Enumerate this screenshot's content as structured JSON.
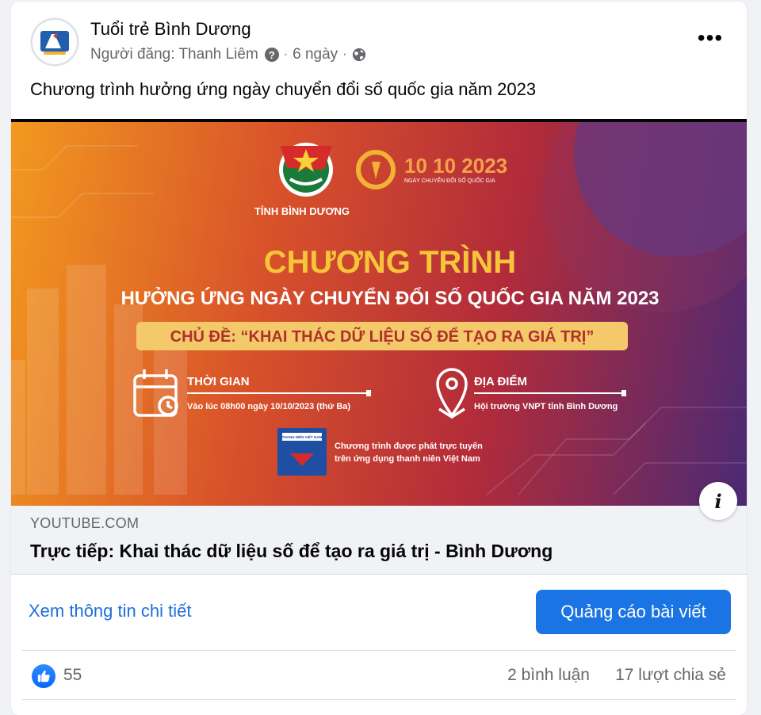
{
  "post": {
    "page_name": "Tuổi trẻ Bình Dương",
    "poster_label": "Người đăng: Thanh Liêm",
    "time": "6 ngày",
    "caption": "Chương trình hưởng ứng ngày chuyển đổi số quốc gia năm 2023"
  },
  "banner": {
    "org": "TỈNH BÌNH DƯƠNG",
    "event_date": "10 10 2023",
    "event_sub": "NGÀY CHUYỂN ĐỔI SỐ QUỐC GIA",
    "heading": "CHƯƠNG TRÌNH",
    "subheading": "HƯỞNG ỨNG NGÀY CHUYỂN ĐỔI SỐ QUỐC GIA NĂM 2023",
    "theme": "CHỦ ĐỀ: “KHAI THÁC DỮ LIỆU SỐ ĐỂ TẠO RA GIÁ TRỊ”",
    "time_label": "THỜI GIAN",
    "time_value": "Vào lúc 08h00 ngày 10/10/2023 (thứ Ba)",
    "place_label": "ĐỊA ĐIỂM",
    "place_value": "Hội trường VNPT tỉnh Bình Dương",
    "app_logo_text": "THANH NIÊN VIỆT NAM",
    "live_line1": "Chương trình được phát trực tuyến",
    "live_line2": "trên ứng dụng thanh niên Việt Nam"
  },
  "link": {
    "domain": "YOUTUBE.COM",
    "title": "Trực tiếp: Khai thác dữ liệu số để tạo ra giá trị - Bình Dương"
  },
  "actions": {
    "details": "Xem thông tin chi tiết",
    "promote": "Quảng cáo bài viết"
  },
  "stats": {
    "likes": "55",
    "comments": "2 bình luận",
    "shares": "17 lượt chia sẻ"
  },
  "colors": {
    "primary": "#1b74e4",
    "link": "#216fdb",
    "muted": "#65676b",
    "banner_gold": "#f7c53a"
  },
  "icons": [
    "more-icon",
    "help-icon",
    "globe-icon",
    "info-icon",
    "like-icon",
    "calendar-icon",
    "location-pin-icon"
  ]
}
